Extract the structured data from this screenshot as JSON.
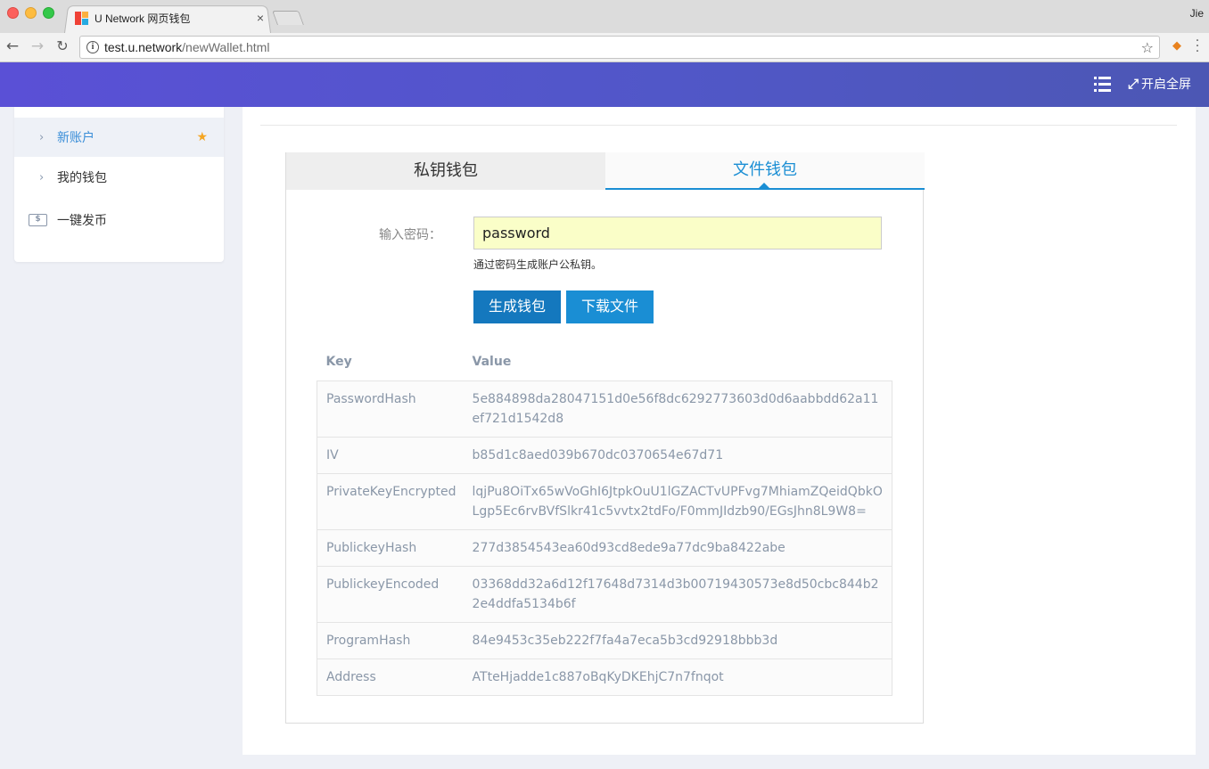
{
  "browser": {
    "tab_title": "U Network 网页钱包",
    "tab_close": "×",
    "profile_name": "Jie",
    "url_host": "test.u.network",
    "url_path": "/newWallet.html"
  },
  "header": {
    "fullscreen_label": "开启全屏",
    "accent_color": "#5457cc"
  },
  "sidebar": {
    "items": [
      {
        "label": "新账户",
        "active": true,
        "starred": true
      },
      {
        "label": "我的钱包",
        "active": false
      },
      {
        "label": "一键发币",
        "icon": "money-icon"
      }
    ]
  },
  "wallet": {
    "tabs": [
      {
        "label": "私钥钱包",
        "active": false
      },
      {
        "label": "文件钱包",
        "active": true
      }
    ],
    "password_label": "输入密码：",
    "password_value": "password",
    "password_hint": "通过密码生成账户公私钥。",
    "generate_button": "生成钱包",
    "download_button": "下载文件",
    "table": {
      "headers": [
        "Key",
        "Value"
      ],
      "rows": [
        {
          "key": "PasswordHash",
          "value": "5e884898da28047151d0e56f8dc6292773603d0d6aabbdd62a11ef721d1542d8"
        },
        {
          "key": "IV",
          "value": "b85d1c8aed039b670dc0370654e67d71"
        },
        {
          "key": "PrivateKeyEncrypted",
          "value": "lqjPu8OiTx65wVoGhI6JtpkOuU1lGZACTvUPFvg7MhiamZQeidQbkOLgp5Ec6rvBVfSlkr41c5vvtx2tdFo/F0mmJIdzb90/EGsJhn8L9W8="
        },
        {
          "key": "PublickeyHash",
          "value": "277d3854543ea60d93cd8ede9a77dc9ba8422abe"
        },
        {
          "key": "PublickeyEncoded",
          "value": "03368dd32a6d12f17648d7314d3b00719430573e8d50cbc844b22e4ddfa5134b6f"
        },
        {
          "key": "ProgramHash",
          "value": "84e9453c35eb222f7fa4a7eca5b3cd92918bbb3d"
        },
        {
          "key": "Address",
          "value": "ATteHjadde1c887oBqKyDKEhjC7n7fnqot"
        }
      ]
    }
  }
}
